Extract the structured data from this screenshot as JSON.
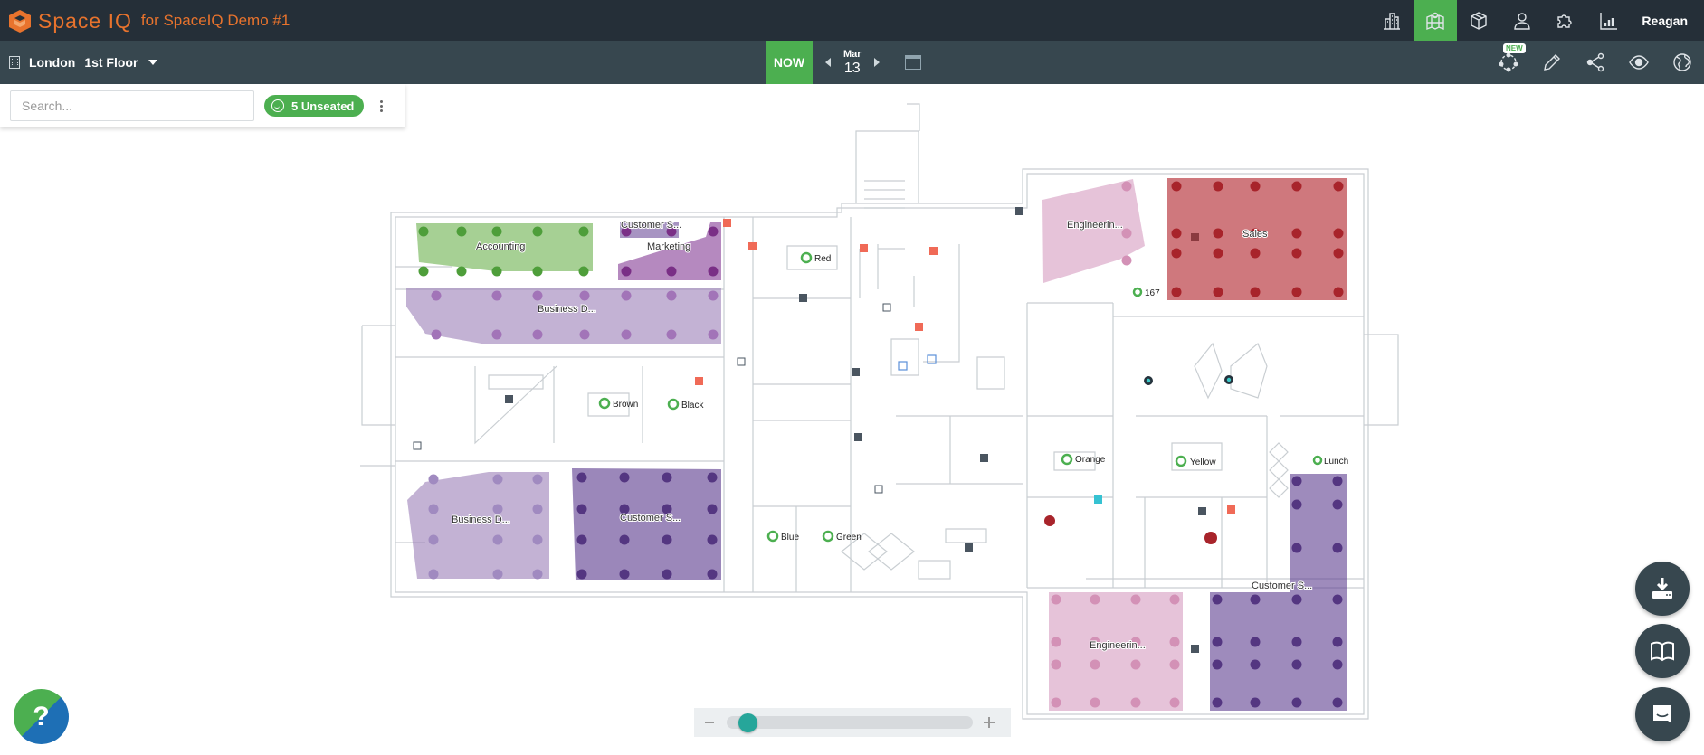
{
  "header": {
    "brand_name": "Space IQ",
    "brand_for": "for SpaceIQ Demo #1",
    "nav": [
      {
        "name": "buildings",
        "icon": "buildings-icon",
        "active": false
      },
      {
        "name": "map",
        "icon": "map-pin-icon",
        "active": true
      },
      {
        "name": "moves",
        "icon": "box-icon",
        "active": false
      },
      {
        "name": "people",
        "icon": "person-icon",
        "active": false
      },
      {
        "name": "integrations",
        "icon": "puzzle-icon",
        "active": false
      },
      {
        "name": "reports",
        "icon": "bar-chart-icon",
        "active": false
      }
    ],
    "user_name": "Reagan",
    "colors": {
      "active_tab": "#4caf50",
      "topbar": "#252f38",
      "subbar": "#37474f",
      "brand": "#e8732d"
    }
  },
  "subbar": {
    "building": "London",
    "floor": "1st Floor",
    "now_label": "NOW",
    "date_month": "Mar",
    "date_day": "13",
    "tools": [
      {
        "name": "planning",
        "icon": "network-icon",
        "badge": "NEW"
      },
      {
        "name": "edit",
        "icon": "pencil-icon"
      },
      {
        "name": "share",
        "icon": "share-icon"
      },
      {
        "name": "view",
        "icon": "eye-icon"
      },
      {
        "name": "globe",
        "icon": "globe-icon"
      }
    ]
  },
  "search": {
    "placeholder": "Search...",
    "value": "",
    "unseated_label": "5 Unseated"
  },
  "floorplan": {
    "zones": [
      {
        "label": "Accounting",
        "color": "#6ab04c"
      },
      {
        "label": "Customer S...",
        "color": "#5e3d8f"
      },
      {
        "label": "Marketing",
        "color": "#8e4a9c"
      },
      {
        "label": "Business D...",
        "color": "#9b7fb8"
      },
      {
        "label": "Engineerin...",
        "color": "#d9a3c4"
      },
      {
        "label": "Sales",
        "color": "#b8383f"
      },
      {
        "label": "Business D...",
        "color": "#9b7fb8"
      },
      {
        "label": "Customer S...",
        "color": "#5e3d8f"
      },
      {
        "label": "Customer S...",
        "color": "#5e3d8f"
      },
      {
        "label": "Engineerin...",
        "color": "#d9a3c4"
      }
    ],
    "rooms": [
      "Red",
      "Brown",
      "Black",
      "Orange",
      "Yellow",
      "Lunch",
      "Blue",
      "Green",
      "167"
    ]
  },
  "zoom": {
    "level": 0.05
  },
  "fabs": [
    {
      "name": "download",
      "icon": "download-icon"
    },
    {
      "name": "guide",
      "icon": "book-icon"
    },
    {
      "name": "chat",
      "icon": "chat-icon"
    }
  ],
  "help_label": "?"
}
